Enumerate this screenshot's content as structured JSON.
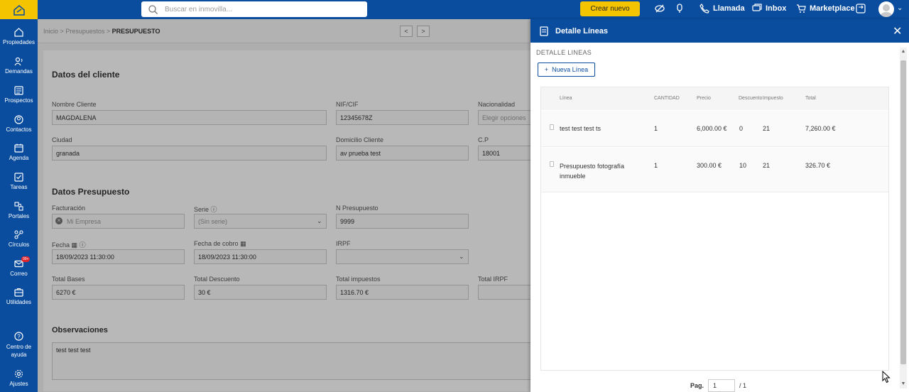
{
  "topbar": {
    "search_placeholder": "Buscar en inmovilla...",
    "crear_label": "Crear nuevo",
    "llamada_label": "Llamada",
    "inbox_label": "Inbox",
    "marketplace_label": "Marketplace"
  },
  "sidebar": {
    "items": [
      {
        "label": "Propiedades",
        "icon": "home-icon"
      },
      {
        "label": "Demandas",
        "icon": "demand-icon"
      },
      {
        "label": "Prospectos",
        "icon": "prospect-icon"
      },
      {
        "label": "Contactos",
        "icon": "contact-icon"
      },
      {
        "label": "Agenda",
        "icon": "calendar-icon"
      },
      {
        "label": "Tareas",
        "icon": "tasks-icon"
      },
      {
        "label": "Portales",
        "icon": "portals-icon"
      },
      {
        "label": "Círculos",
        "icon": "circles-icon"
      },
      {
        "label": "Correo",
        "icon": "mail-icon"
      },
      {
        "label": "Utilidades",
        "icon": "tools-icon"
      }
    ],
    "mail_badge": "99+",
    "help_label_1": "Centro de",
    "help_label_2": "ayuda",
    "settings_label": "Ajustes"
  },
  "breadcrumb": {
    "part1": "Inicio",
    "sep": ">",
    "part2": "Presupuestos",
    "current": "PRESUPUESTO",
    "prev": "<",
    "next": ">"
  },
  "cliente": {
    "title": "Datos del cliente",
    "nombre_label": "Nombre Cliente",
    "nombre_value": "MAGDALENA",
    "nif_label": "NIF/CIF",
    "nif_value": "12345678Z",
    "nacionalidad_label": "Nacionalidad",
    "nacionalidad_value": "Elegir opciones",
    "ciudad_label": "Ciudad",
    "ciudad_value": "granada",
    "domicilio_label": "Domicilio Cliente",
    "domicilio_value": "av prueba test",
    "cp_label": "C.P",
    "cp_value": "18001"
  },
  "presupuesto": {
    "title": "Datos Presupuesto",
    "facturacion_label": "Facturación",
    "facturacion_value": "Mi Empresa",
    "serie_label": "Serie",
    "serie_value": "(Sin serie)",
    "npres_label": "N Presupuesto",
    "npres_value": "9999",
    "fecha_label": "Fecha",
    "fecha_value": "18/09/2023 11:30:00",
    "fechacobro_label": "Fecha de cobro",
    "fechacobro_value": "18/09/2023 11:30:00",
    "irpf_label": "IRPF",
    "bases_label": "Total Bases",
    "bases_value": "6270 €",
    "descuento_label": "Total Descuento",
    "descuento_value": "30 €",
    "impuestos_label": "Total impuestos",
    "impuestos_value": "1316.70 €",
    "totalirpf_label": "Total IRPF",
    "obs_title": "Observaciones",
    "obs_value": "test test test"
  },
  "panel": {
    "title": "Detalle Líneas",
    "subtitle": "DETALLE LINEAS",
    "nueva_label": "Nueva Línea",
    "columns": {
      "linea": "Línea",
      "cantidad": "CANTIDAD",
      "precio": "Precio",
      "descuento": "Descuento",
      "impuesto": "Impuesto",
      "total": "Total"
    },
    "rows": [
      {
        "linea": "test test test ts",
        "linea2": "",
        "cantidad": "1",
        "precio": "6,000.00 €",
        "descuento": "0",
        "impuesto": "21",
        "total": "7,260.00 €"
      },
      {
        "linea": "Presupuesto fotografía",
        "linea2": "inmueble",
        "cantidad": "1",
        "precio": "300.00 €",
        "descuento": "10",
        "impuesto": "21",
        "total": "326.70 €"
      }
    ],
    "page_label": "Pag.",
    "page_value": "1",
    "page_total": "/ 1"
  }
}
